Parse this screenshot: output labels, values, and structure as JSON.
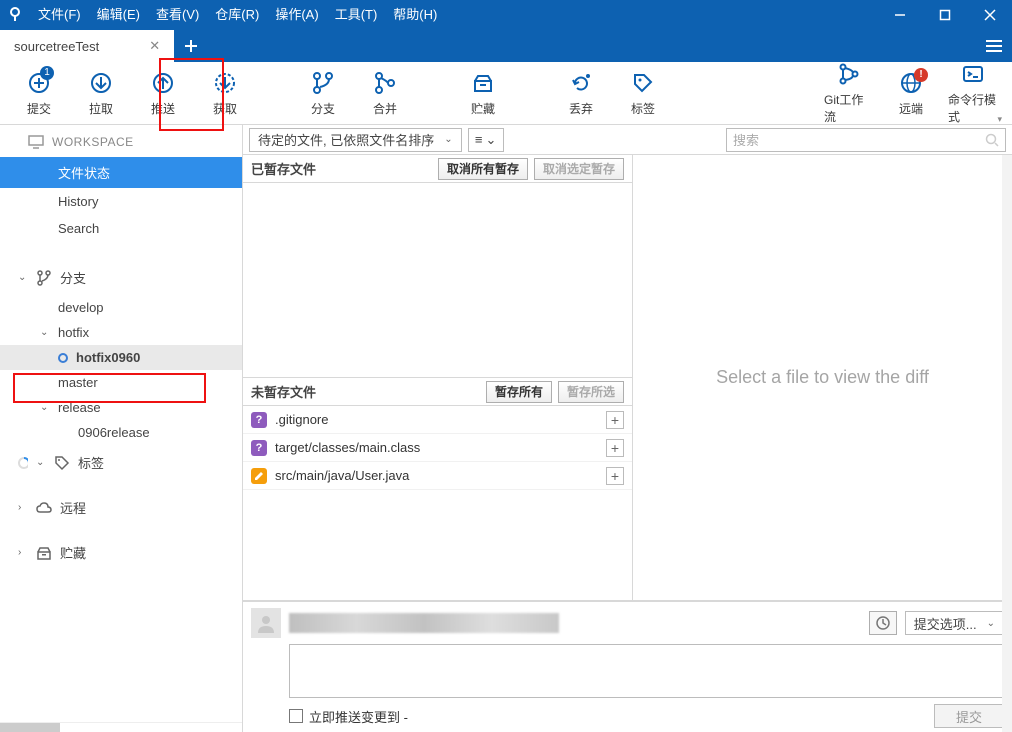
{
  "menu": {
    "items": [
      "文件(F)",
      "编辑(E)",
      "查看(V)",
      "仓库(R)",
      "操作(A)",
      "工具(T)",
      "帮助(H)"
    ]
  },
  "tab": {
    "title": "sourcetreeTest"
  },
  "toolbar": {
    "commit": {
      "label": "提交",
      "badge": "1"
    },
    "pull": {
      "label": "拉取"
    },
    "push": {
      "label": "推送"
    },
    "fetch": {
      "label": "获取"
    },
    "branch": {
      "label": "分支"
    },
    "merge": {
      "label": "合并"
    },
    "stash": {
      "label": "贮藏"
    },
    "discard": {
      "label": "丢弃"
    },
    "tag": {
      "label": "标签"
    },
    "gitflow": {
      "label": "Git工作流"
    },
    "remote": {
      "label": "远端"
    },
    "terminal": {
      "label": "命令行模式"
    }
  },
  "sidebar": {
    "workspace": {
      "header": "WORKSPACE",
      "items": [
        "文件状态",
        "History",
        "Search"
      ],
      "selectedIndex": 0
    },
    "branches": {
      "header": "分支",
      "items": [
        {
          "name": "develop"
        },
        {
          "name": "hotfix",
          "expanded": true,
          "children": [
            {
              "name": "hotfix0960",
              "current": true
            }
          ]
        },
        {
          "name": "master"
        },
        {
          "name": "release",
          "expanded": true,
          "children": [
            {
              "name": "0906release"
            }
          ]
        }
      ]
    },
    "tags": {
      "header": "标签"
    },
    "remotes": {
      "header": "远程"
    },
    "stashes": {
      "header": "贮藏"
    }
  },
  "filter": {
    "pending": "待定的文件, 已依照文件名排序",
    "searchPlaceholder": "搜索"
  },
  "staged": {
    "header": "已暂存文件",
    "btnUnstageAll": "取消所有暂存",
    "btnUnstageSel": "取消选定暂存"
  },
  "unstaged": {
    "header": "未暂存文件",
    "btnStageAll": "暂存所有",
    "btnStageSel": "暂存所选",
    "files": [
      {
        "status": "?",
        "kind": "unk",
        "name": ".gitignore"
      },
      {
        "status": "?",
        "kind": "unk",
        "name": "target/classes/main.class"
      },
      {
        "status": "M",
        "kind": "mod",
        "name": "src/main/java/User.java"
      }
    ]
  },
  "diff": {
    "placeholder": "Select a file to view the diff"
  },
  "commit": {
    "optionsLabel": "提交选项...",
    "pushCheckboxLabel": "立即推送变更到",
    "pushSuffix": "-",
    "submitLabel": "提交"
  }
}
